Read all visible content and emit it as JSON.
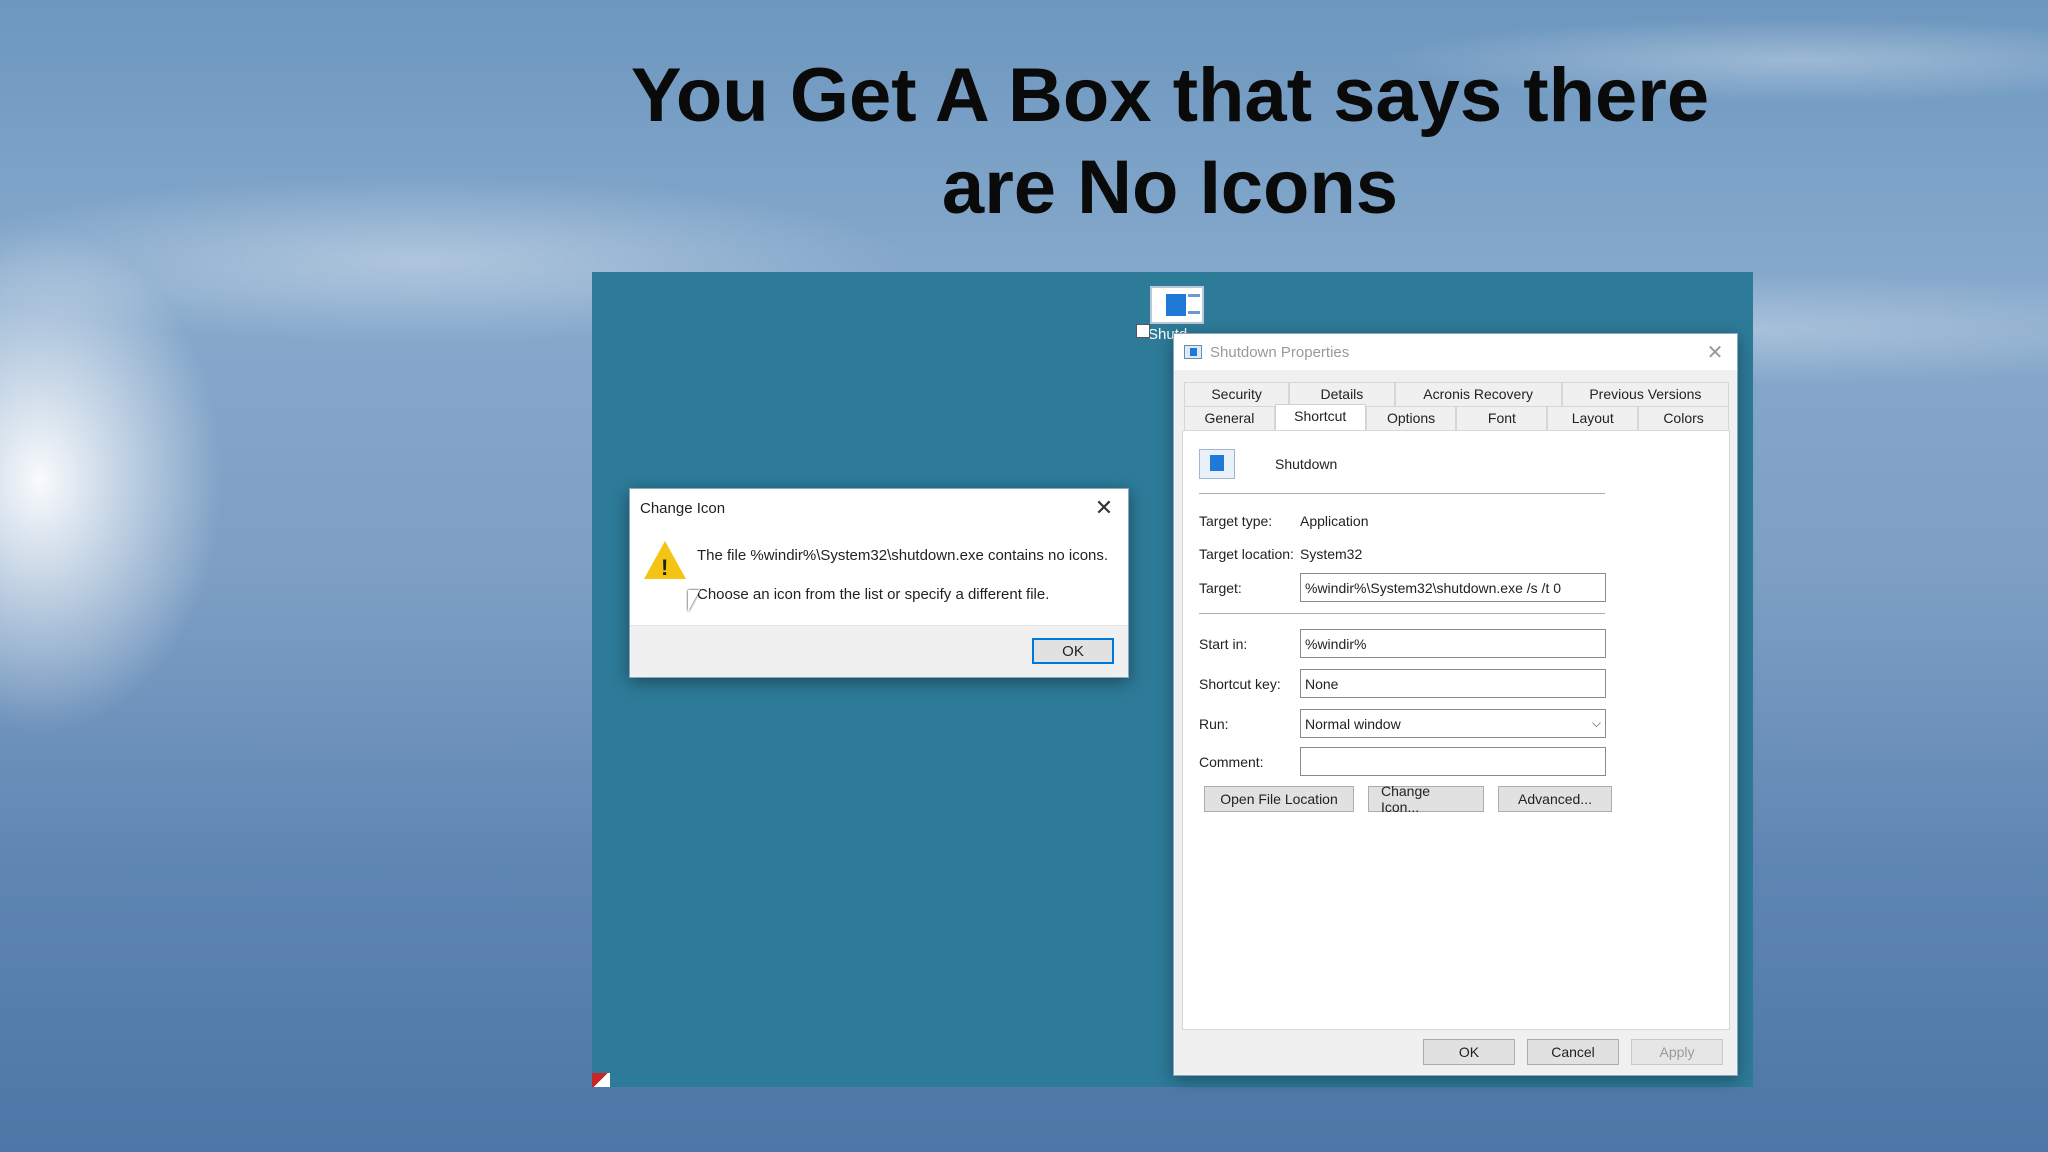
{
  "slide": {
    "title_line1": "You Get A Box that says there",
    "title_line2": "are No Icons"
  },
  "desktop": {
    "shortcut_label": "Shutd"
  },
  "properties_window": {
    "title": "Shutdown Properties",
    "close_glyph": "✕",
    "tabs_row1": [
      "Security",
      "Details",
      "Acronis Recovery",
      "Previous Versions"
    ],
    "tabs_row2": [
      "General",
      "Shortcut",
      "Options",
      "Font",
      "Layout",
      "Colors"
    ],
    "active_tab": "Shortcut",
    "shortcut_name": "Shutdown",
    "target_type_label": "Target type:",
    "target_type_value": "Application",
    "target_location_label": "Target location:",
    "target_location_value": "System32",
    "target_label": "Target:",
    "target_value": "%windir%\\System32\\shutdown.exe /s /t 0",
    "start_in_label": "Start in:",
    "start_in_value": "%windir%",
    "shortcut_key_label": "Shortcut key:",
    "shortcut_key_value": "None",
    "run_label": "Run:",
    "run_value": "Normal window",
    "comment_label": "Comment:",
    "comment_value": "",
    "open_file_location": "Open File Location",
    "change_icon": "Change Icon...",
    "advanced": "Advanced...",
    "ok": "OK",
    "cancel": "Cancel",
    "apply": "Apply"
  },
  "change_icon_dialog": {
    "title": "Change Icon",
    "close_glyph": "✕",
    "message1": "The file %windir%\\System32\\shutdown.exe contains no icons.",
    "message2": "Choose an icon from the list or specify a different file.",
    "ok": "OK"
  }
}
